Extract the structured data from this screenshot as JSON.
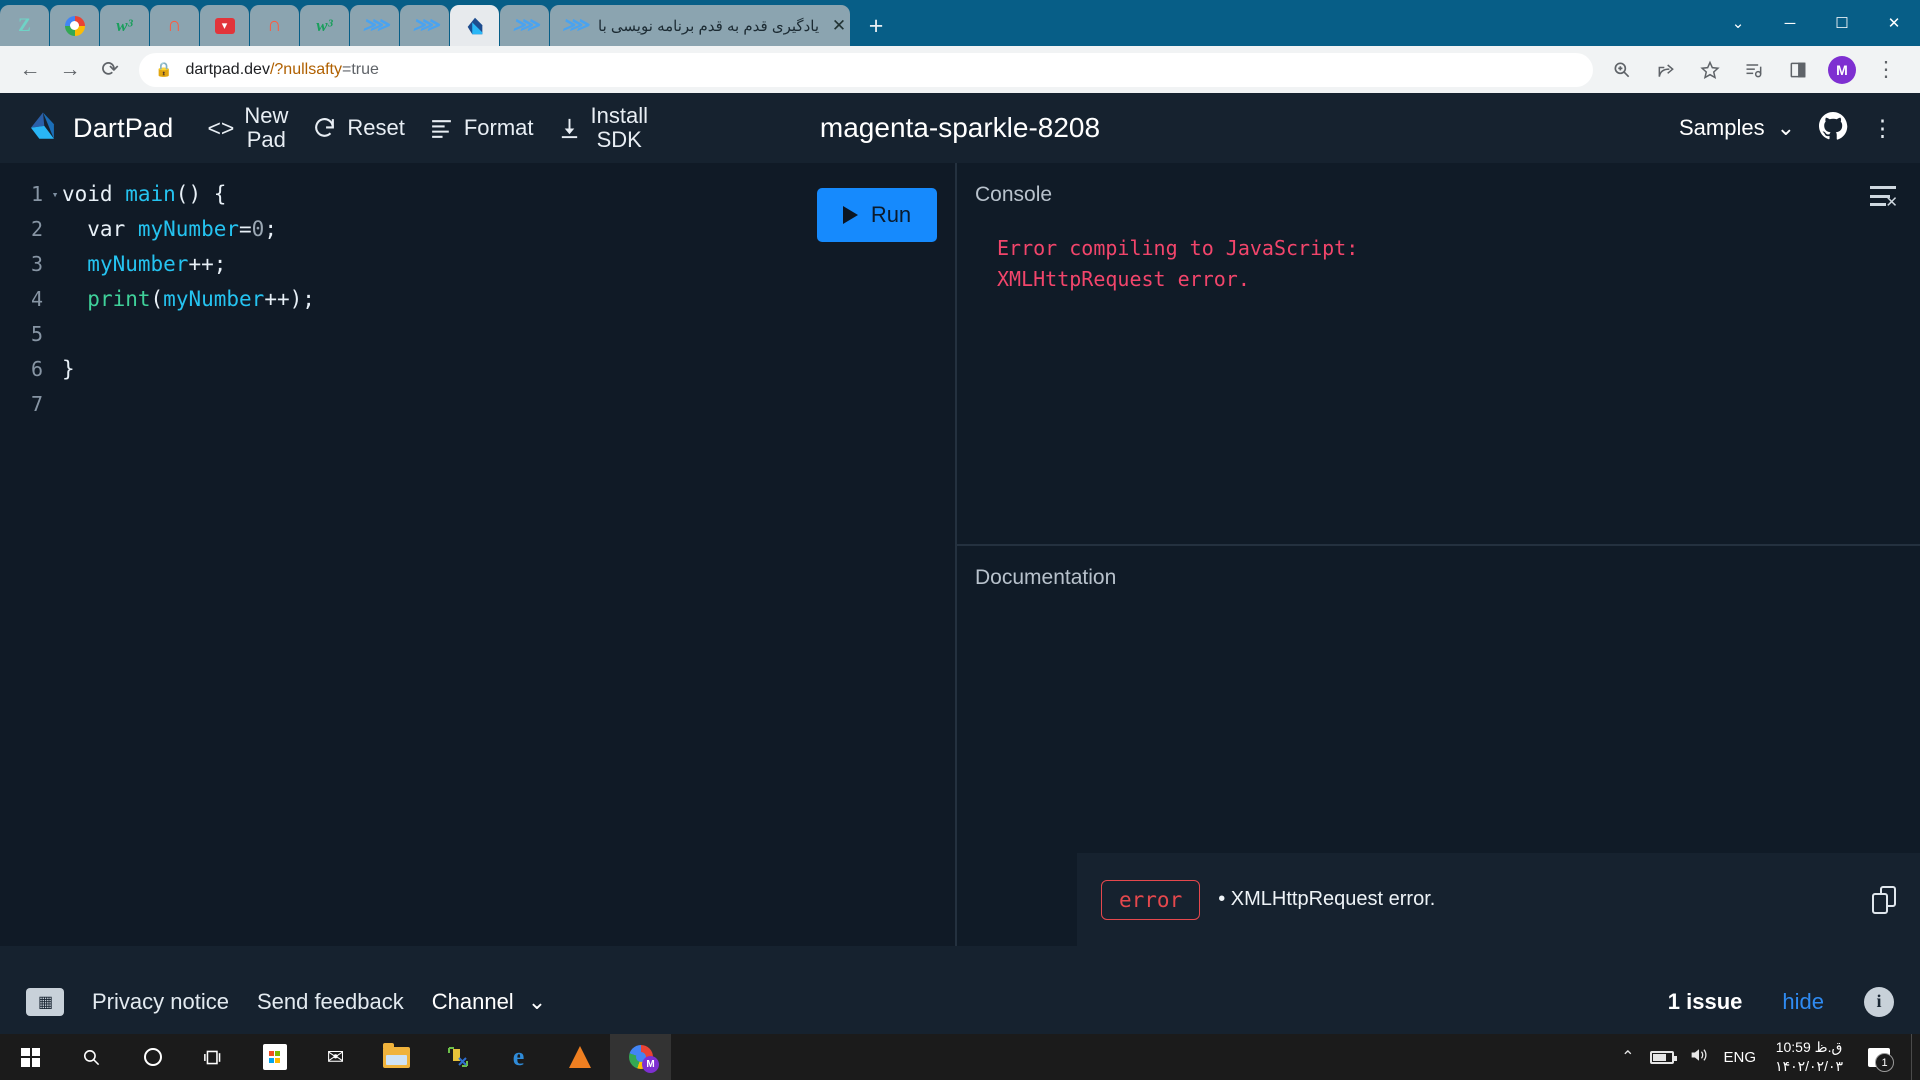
{
  "browser": {
    "tabs": [
      {
        "favicon": "zoho-icon",
        "title": ""
      },
      {
        "favicon": "google-icon",
        "title": ""
      },
      {
        "favicon": "w3schools-icon",
        "title": ""
      },
      {
        "favicon": "magnet-icon",
        "title": ""
      },
      {
        "favicon": "red-note-icon",
        "title": ""
      },
      {
        "favicon": "magnet-icon",
        "title": ""
      },
      {
        "favicon": "w3schools-icon",
        "title": ""
      },
      {
        "favicon": "flutter-icon",
        "title": ""
      },
      {
        "favicon": "flutter-icon",
        "title": ""
      },
      {
        "favicon": "dart-icon",
        "title": "",
        "active": true
      },
      {
        "favicon": "flutter-icon",
        "title": ""
      }
    ],
    "active_tab": {
      "favicon": "flutter-icon",
      "title": "یادگیری قدم به قدم برنامه نویسی با",
      "close_label": "✕"
    },
    "new_tab_label": "+",
    "window_controls": {
      "dropdown": "⌄",
      "minimize": "─",
      "maximize": "☐",
      "close": "✕"
    },
    "nav": {
      "back": "←",
      "forward": "→",
      "reload": "⟳"
    },
    "url": {
      "lock_icon": "lock-icon",
      "host": "dartpad.dev",
      "query": "/?nullsafty",
      "value": "=true",
      "full": "dartpad.dev/?nullsafty=true"
    },
    "omnibox_icons": {
      "zoom": "zoom-icon",
      "share": "share-icon",
      "bookmark": "star-icon",
      "media": "media-playlist-icon",
      "reading_list": "reading-list-icon",
      "profile_initial": "M",
      "menu": "⋮"
    }
  },
  "dartpad": {
    "brand": "DartPad",
    "logo_icon": "dart-logo-icon",
    "toolbar": {
      "code_icon": "<>",
      "new_pad_line1": "New",
      "new_pad_line2": "Pad",
      "reset_icon": "refresh-icon",
      "reset_label": "Reset",
      "format_icon": "format-lines-icon",
      "format_label": "Format",
      "install_icon": "download-icon",
      "install_line1": "Install",
      "install_line2": "SDK"
    },
    "pad_title": "magenta-sparkle-8208",
    "samples_label": "Samples",
    "samples_chevron": "⌄",
    "github_icon": "github-icon",
    "more_menu_icon": "⋮",
    "run_button": "Run",
    "editor": {
      "lines": [
        {
          "n": "1",
          "fold": "▾",
          "tokens": [
            {
              "t": "void ",
              "c": "c-white"
            },
            {
              "t": "main",
              "c": "c-cyan"
            },
            {
              "t": "() {",
              "c": "c-punc"
            }
          ]
        },
        {
          "n": "2",
          "fold": "",
          "tokens": [
            {
              "t": "  var ",
              "c": "c-white"
            },
            {
              "t": "myNumber",
              "c": "c-cyan"
            },
            {
              "t": "=",
              "c": "c-punc"
            },
            {
              "t": "0",
              "c": "c-num"
            },
            {
              "t": ";",
              "c": "c-punc"
            }
          ]
        },
        {
          "n": "3",
          "fold": "",
          "tokens": [
            {
              "t": "  ",
              "c": "c-white"
            },
            {
              "t": "myNumber",
              "c": "c-cyan"
            },
            {
              "t": "++;",
              "c": "c-punc"
            }
          ]
        },
        {
          "n": "4",
          "fold": "",
          "tokens": [
            {
              "t": "  ",
              "c": "c-white"
            },
            {
              "t": "print",
              "c": "c-green"
            },
            {
              "t": "(",
              "c": "c-punc"
            },
            {
              "t": "myNumber",
              "c": "c-cyan"
            },
            {
              "t": "++",
              "c": "c-punc"
            },
            {
              "t": ");",
              "c": "c-punc"
            }
          ]
        },
        {
          "n": "5",
          "fold": "",
          "tokens": []
        },
        {
          "n": "6",
          "fold": "",
          "tokens": [
            {
              "t": "}",
              "c": "c-punc"
            }
          ]
        },
        {
          "n": "7",
          "fold": "",
          "tokens": []
        }
      ]
    },
    "console": {
      "title": "Console",
      "clear_icon": "clear-console-icon",
      "output": "Error compiling to JavaScript:\nXMLHttpRequest error."
    },
    "documentation": {
      "title": "Documentation"
    },
    "issue_panel": {
      "badge": "error",
      "bullet": "•",
      "message": "XMLHttpRequest error.",
      "copy_icon": "copy-icon"
    },
    "footer": {
      "keyboard_icon": "keyboard-icon",
      "privacy": "Privacy notice",
      "feedback": "Send feedback",
      "channel": "Channel",
      "channel_chevron": "⌄",
      "issue_count": "1 issue",
      "hide": "hide",
      "info_icon": "info-icon"
    }
  },
  "taskbar": {
    "items": [
      {
        "icon": "windows-start-icon"
      },
      {
        "icon": "search-icon"
      },
      {
        "icon": "cortana-icon"
      },
      {
        "icon": "task-view-icon"
      },
      {
        "icon": "microsoft-store-icon"
      },
      {
        "icon": "mail-icon"
      },
      {
        "icon": "file-explorer-icon"
      },
      {
        "icon": "snip-tool-icon"
      },
      {
        "icon": "edge-icon"
      },
      {
        "icon": "vlc-icon"
      },
      {
        "icon": "chrome-icon",
        "badge": "M",
        "active": true
      }
    ],
    "tray": {
      "chevron": "⌃",
      "battery_icon": "battery-icon",
      "volume_icon": "🔊",
      "language": "ENG",
      "time": "ق.ظ 10:59",
      "date": "۱۴۰۲/۰۲/۰۳",
      "notification_icon": "notification-icon",
      "notification_count": "1"
    }
  },
  "colors": {
    "accent_blue": "#168afd",
    "error_red": "#e5484d",
    "console_red": "#f2456b",
    "link_blue": "#2f8bf2",
    "browser_chrome": "#075e87",
    "app_bg": "#111b27"
  }
}
